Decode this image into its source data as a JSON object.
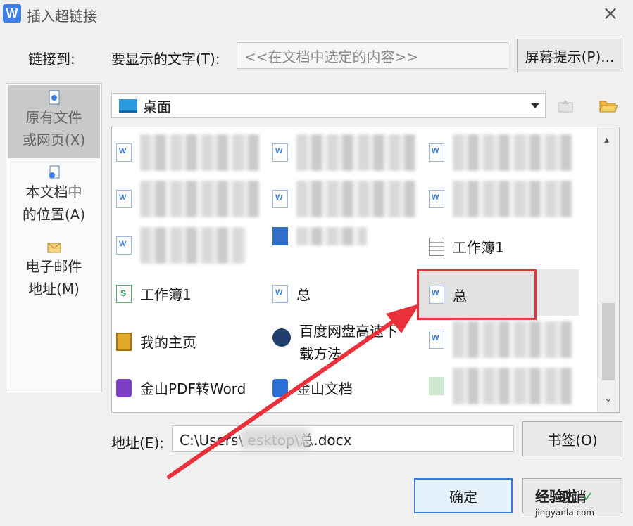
{
  "window": {
    "title": "插入超链接",
    "app_icon_letter": "W"
  },
  "header": {
    "link_to_label": "链接到:",
    "display_text_label": "要显示的文字(T):",
    "display_text_value": "<<在文档中选定的内容>>",
    "screen_tip_button": "屏幕提示(P)..."
  },
  "nav": {
    "items": [
      {
        "label_line1": "原有文件",
        "label_line2": "或网页(X)",
        "active": true
      },
      {
        "label_line1": "本文档中",
        "label_line2": "的位置(A)",
        "active": false
      },
      {
        "label_line1": "电子邮件",
        "label_line2": "地址(M)",
        "active": false
      }
    ]
  },
  "folder": {
    "current": "桌面"
  },
  "files": {
    "workbook_a": "工作簿1",
    "workbook_b": "工作簿1",
    "doc_a": "总",
    "doc_selected": "总",
    "homepage": "我的主页",
    "baidu_line1": "百度网盘高速下",
    "baidu_line2": "载方法",
    "pdf_converter": "金山PDF转Word",
    "kingsoft_docs": "金山文档"
  },
  "address": {
    "label": "地址(E):",
    "value": "C:\\Users\\         esktop\\总.docx",
    "bookmark_button": "书签(O)"
  },
  "buttons": {
    "ok": "确定",
    "cancel": "取消"
  },
  "watermark": {
    "text": "经验啦",
    "url": "jingyanla.com"
  },
  "colors": {
    "accent": "#3d7fe6",
    "annotation_red": "#e8313a"
  }
}
